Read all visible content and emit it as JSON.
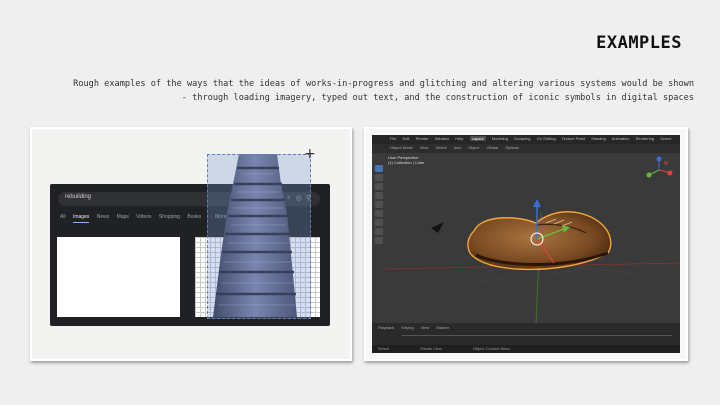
{
  "slide": {
    "title": "EXAMPLES",
    "description_line1": "Rough examples of the ways that the ideas of works-in-progress and glitching and altering various systems would be shown",
    "description_line2": "- through loading imagery, typed out text, and the construction of iconic symbols in digital spaces"
  },
  "google": {
    "search_value": "rebuilding",
    "search_icons": [
      "mic-icon",
      "lens-icon",
      "search-icon"
    ],
    "tabs": [
      "All",
      "Images",
      "News",
      "Maps",
      "Videos",
      "Shopping",
      "Books",
      "⋮ More"
    ],
    "active_tab": "Images"
  },
  "blender": {
    "menu": [
      "File",
      "Edit",
      "Render",
      "Window",
      "Help",
      "Layout",
      "Modeling",
      "Sculpting",
      "UV Editing",
      "Texture Paint",
      "Shading",
      "Animation",
      "Rendering",
      "Scene"
    ],
    "active_workspace": "Layout",
    "header": [
      "Object Mode",
      "View",
      "Select",
      "Add",
      "Object",
      "Global",
      "Options"
    ],
    "view_label_1": "User Perspective",
    "view_label_2": "(1) Collection | Cube",
    "timeline": [
      "Playback",
      "Keying",
      "View",
      "Marker"
    ],
    "status": [
      "Select",
      "Rotate View",
      "Object Context Menu"
    ],
    "colors": {
      "x_axis": "#e0413b",
      "y_axis": "#6ab43c",
      "z_axis": "#3a6fd8",
      "shoe": "#8b5a2b",
      "outline": "#f2a53a"
    }
  }
}
